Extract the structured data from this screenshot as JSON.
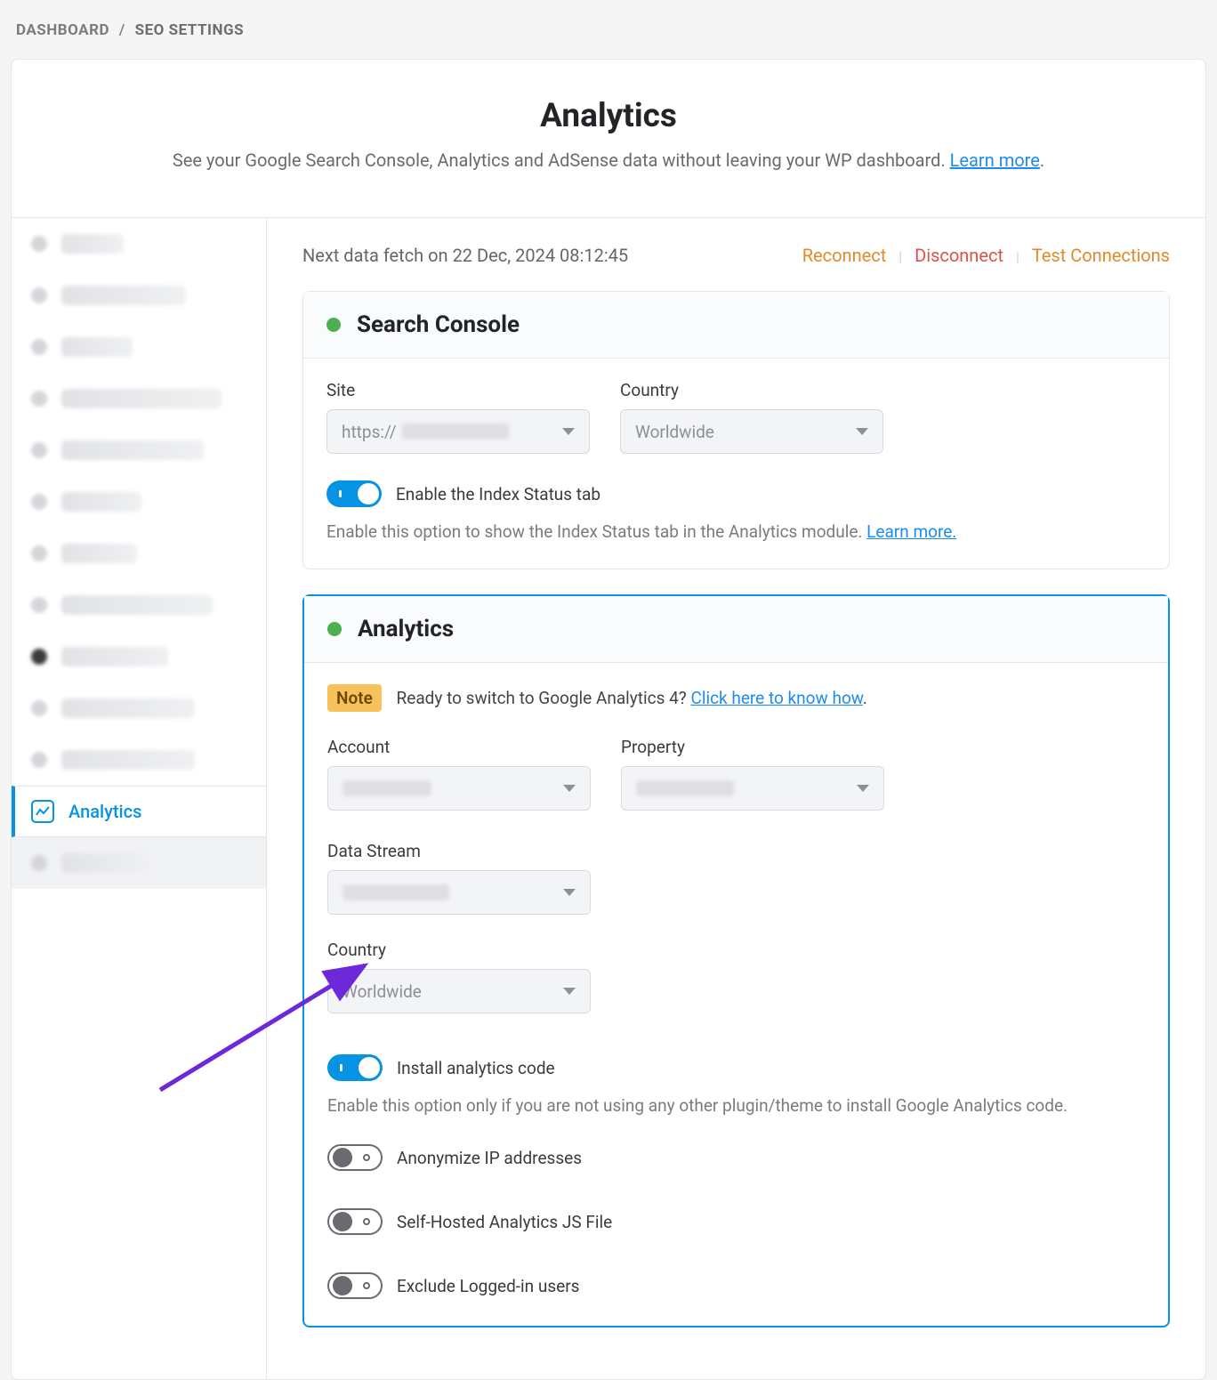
{
  "breadcrumb": {
    "root": "DASHBOARD",
    "current": "SEO SETTINGS"
  },
  "header": {
    "title": "Analytics",
    "subtitle_pre": "See your Google Search Console, Analytics and AdSense data without leaving your WP dashboard. ",
    "learn_more": "Learn more"
  },
  "sidebar": {
    "active_label": "Analytics"
  },
  "meta": {
    "fetch_text": "Next data fetch on 22 Dec, 2024 08:12:45",
    "reconnect": "Reconnect",
    "disconnect": "Disconnect",
    "test": "Test Connections"
  },
  "search_console": {
    "title": "Search Console",
    "site_label": "Site",
    "site_value_prefix": "https://",
    "country_label": "Country",
    "country_value": "Worldwide",
    "toggle_label": "Enable the Index Status tab",
    "help_pre": "Enable this option to show the Index Status tab in the Analytics module. ",
    "help_link": "Learn more."
  },
  "analytics": {
    "title": "Analytics",
    "note_badge": "Note",
    "note_text": "Ready to switch to Google Analytics 4? ",
    "note_link": "Click here to know how",
    "account_label": "Account",
    "property_label": "Property",
    "stream_label": "Data Stream",
    "country_label": "Country",
    "country_value": "Worldwide",
    "install_label": "Install analytics code",
    "install_help": "Enable this option only if you are not using any other plugin/theme to install Google Analytics code.",
    "anonymize_label": "Anonymize IP addresses",
    "selfhost_label": "Self-Hosted Analytics JS File",
    "exclude_label": "Exclude Logged-in users"
  }
}
